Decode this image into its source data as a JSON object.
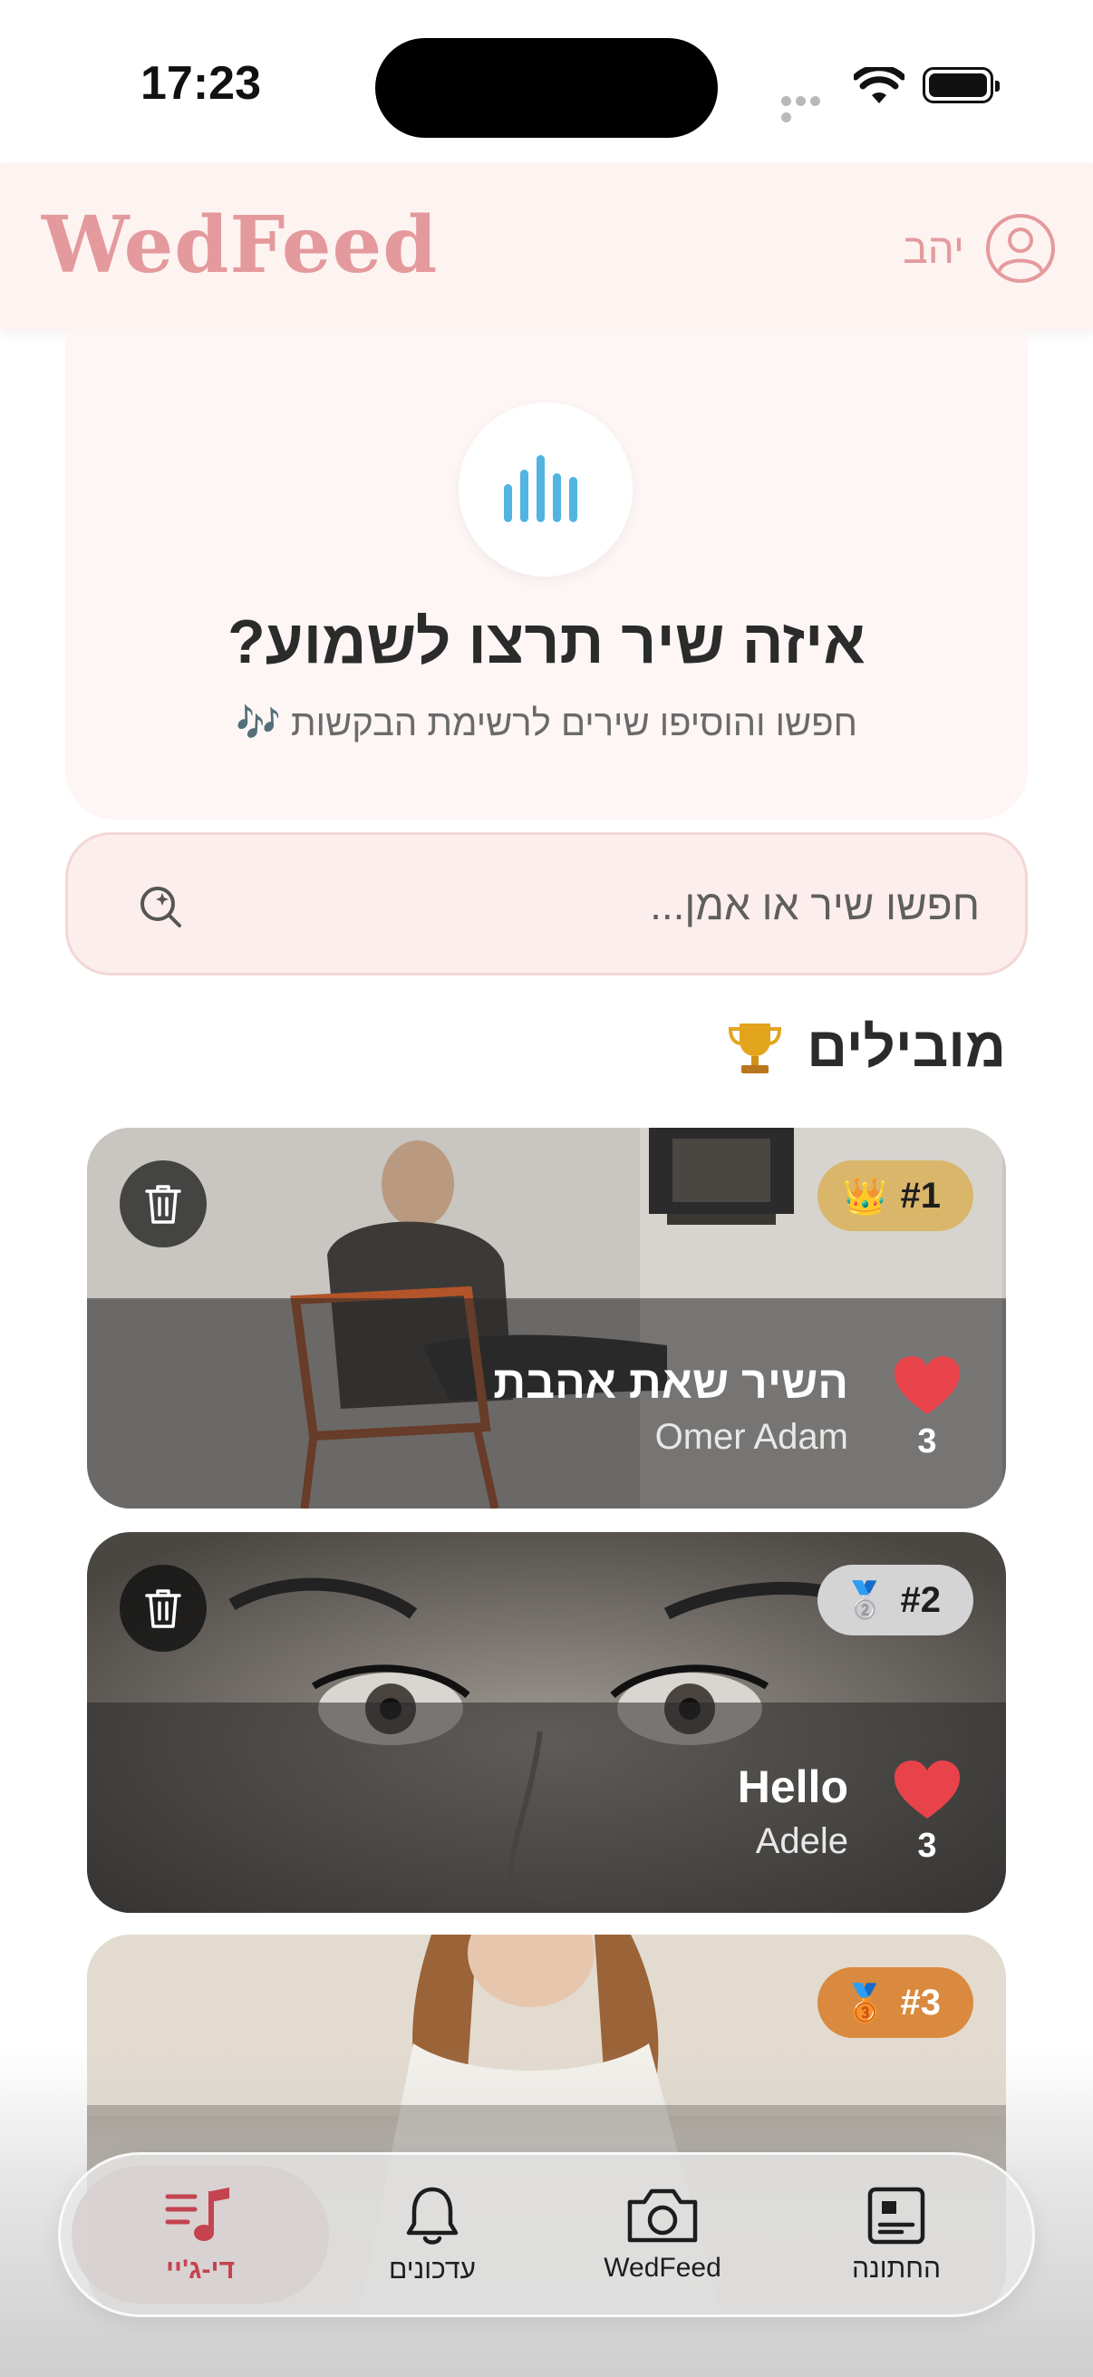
{
  "status_bar": {
    "time": "17:23"
  },
  "header": {
    "logo": "WedFeed",
    "user_name": "יהב"
  },
  "hero": {
    "title": "איזה שיר תרצו לשמוע?",
    "subtitle": "חפשו והוסיפו שירים לרשימת הבקשות 🎶"
  },
  "search": {
    "placeholder": "חפשו שיר או אמן..."
  },
  "leaders": {
    "title": "מובילים",
    "icon": "trophy-icon"
  },
  "songs": [
    {
      "rank": "#1",
      "medal": "👑",
      "title": "השיר שאת אהבת",
      "artist": "Omer Adam",
      "likes": "3",
      "badge_color": "#d9b66a"
    },
    {
      "rank": "#2",
      "medal": "🥈",
      "title": "Hello",
      "artist": "Adele",
      "likes": "3",
      "badge_color": "#d4d4d4"
    },
    {
      "rank": "#3",
      "medal": "🥉",
      "title": "",
      "artist": "",
      "likes": "",
      "badge_color": "#d98a3e"
    }
  ],
  "tabbar": {
    "tabs": [
      {
        "label": "די-ג'יי",
        "icon": "music-note-icon",
        "active": true
      },
      {
        "label": "עדכונים",
        "icon": "bell-icon",
        "active": false
      },
      {
        "label": "WedFeed",
        "icon": "camera-icon",
        "active": false
      },
      {
        "label": "החתונה",
        "icon": "wedding-card-icon",
        "active": false
      }
    ]
  },
  "colors": {
    "brand": "#e49a9d",
    "like": "#e8434b",
    "accent_blue": "#52b4e0"
  }
}
